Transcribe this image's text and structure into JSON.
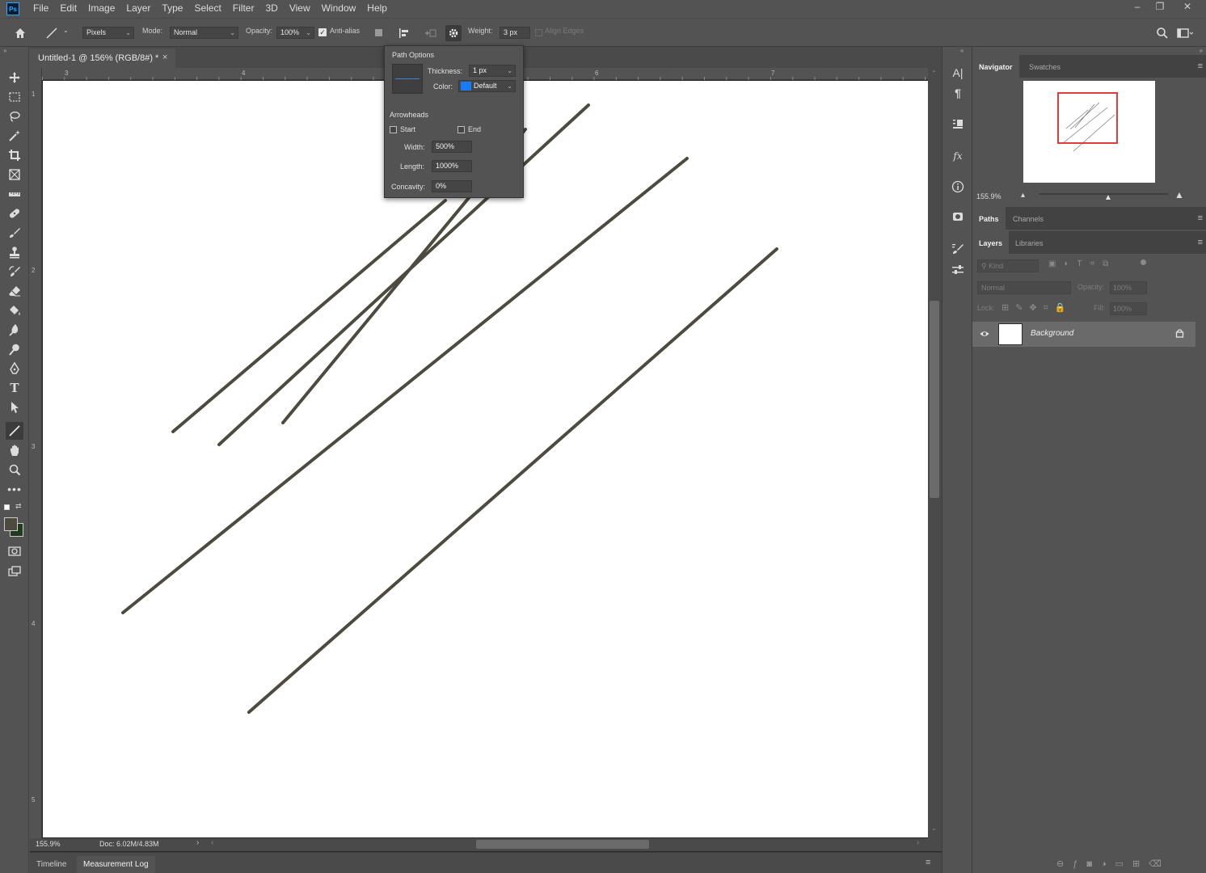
{
  "app": {
    "logo": "Ps"
  },
  "menu": [
    "File",
    "Edit",
    "Image",
    "Layer",
    "Type",
    "Select",
    "Filter",
    "3D",
    "View",
    "Window",
    "Help"
  ],
  "window_controls": {
    "minimize": "–",
    "restore": "❐",
    "close": "✕"
  },
  "options": {
    "fill_mode": "Pixels",
    "mode_label": "Mode:",
    "mode_value": "Normal",
    "opacity_label": "Opacity:",
    "opacity_value": "100%",
    "antialias_label": "Anti-alias",
    "antialias_checked": true,
    "weight_label": "Weight:",
    "weight_value": "3 px",
    "align_edges_label": "Align Edges"
  },
  "document": {
    "tab_title": "Untitled-1 @ 156% (RGB/8#) *",
    "ruler_h": [
      "3",
      "4",
      "6",
      "7"
    ],
    "ruler_v": [
      "1",
      "2",
      "3",
      "4",
      "5"
    ],
    "zoom": "155.9%",
    "doc_size": "Doc: 6.02M/4.83M"
  },
  "bottom_tabs": [
    "Timeline",
    "Measurement Log"
  ],
  "path_options": {
    "title": "Path Options",
    "thickness_label": "Thickness:",
    "thickness_value": "1 px",
    "color_label": "Color:",
    "color_value": "Default",
    "color_swatch": "#1a7cf5",
    "arrowheads_label": "Arrowheads",
    "start_label": "Start",
    "end_label": "End",
    "width_label": "Width:",
    "width_value": "500%",
    "length_label": "Length:",
    "length_value": "1000%",
    "concavity_label": "Concavity:",
    "concavity_value": "0%"
  },
  "colors": {
    "foreground": "#4e4a40",
    "background": "#1f3a1f",
    "line_color": "#4d4a3f",
    "nav_frame": "#e23b3b"
  },
  "panels": {
    "navigator_tab": "Navigator",
    "swatches_tab": "Swatches",
    "nav_zoom": "155.9%",
    "paths_tab": "Paths",
    "channels_tab": "Channels",
    "layers_tab": "Layers",
    "libraries_tab": "Libraries",
    "kind_placeholder": "Kind",
    "blend_mode": "Normal",
    "opacity_label": "Opacity:",
    "opacity_value": "100%",
    "lock_label": "Lock:",
    "fill_label": "Fill:",
    "fill_value": "100%",
    "layer_name": "Background"
  }
}
